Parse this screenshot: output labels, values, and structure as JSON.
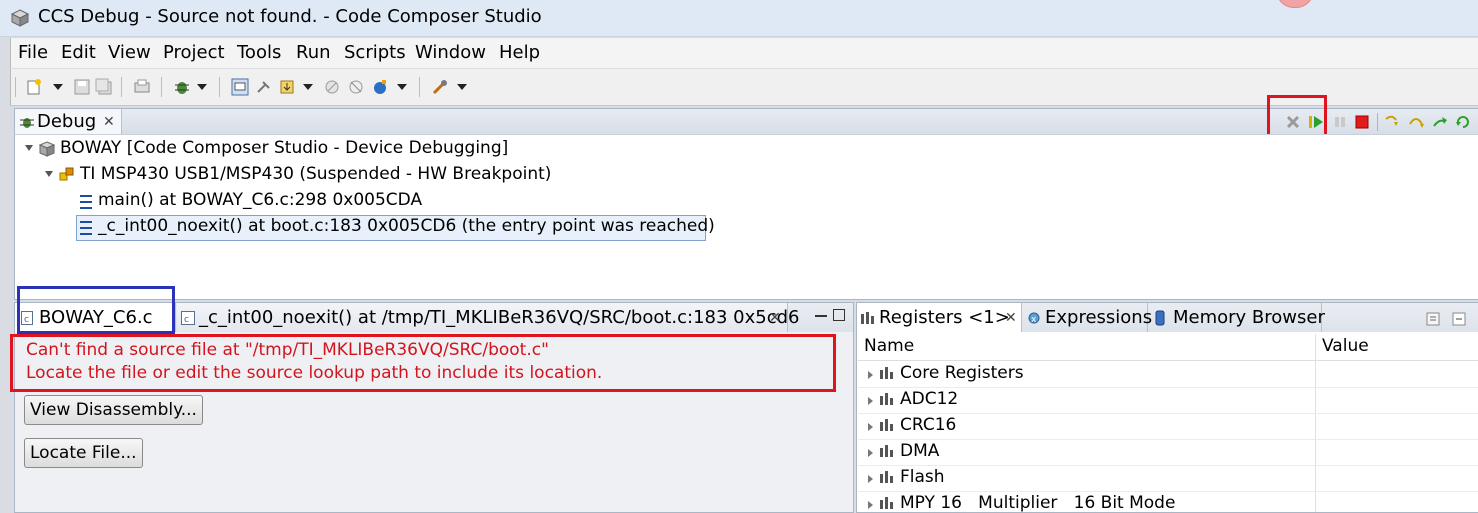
{
  "window": {
    "title": "CCS Debug - Source not found. - Code Composer Studio"
  },
  "menu": [
    "File",
    "Edit",
    "View",
    "Project",
    "Tools",
    "Run",
    "Scripts",
    "Window",
    "Help"
  ],
  "debug_view": {
    "tab_label": "Debug",
    "tree": {
      "session": "BOWAY [Code Composer Studio - Device Debugging]",
      "target": "TI MSP430 USB1/MSP430 (Suspended - HW Breakpoint)",
      "frames": [
        "main() at BOWAY_C6.c:298 0x005CDA",
        "_c_int00_noexit() at boot.c:183 0x005CD6  (the entry point was reached)"
      ]
    }
  },
  "editor": {
    "tabs": [
      "BOWAY_C6.c",
      "_c_int00_noexit() at /tmp/TI_MKLIBeR36VQ/SRC/boot.c:183 0x5cd6"
    ],
    "error_line1": "Can't find a source file at \"/tmp/TI_MKLIBeR36VQ/SRC/boot.c\"",
    "error_line2": "Locate the file or edit the source lookup path to include its location.",
    "view_disassembly_label": "View Disassembly...",
    "locate_file_label": "Locate File..."
  },
  "registers_view": {
    "tabs": [
      "Registers <1>",
      "Expressions",
      "Memory Browser"
    ],
    "columns": [
      "Name",
      "Value"
    ],
    "rows": [
      "Core Registers",
      "ADC12",
      "CRC16",
      "DMA",
      "Flash",
      "MPY 16   Multiplier   16 Bit Mode"
    ]
  },
  "colors": {
    "highlight_red": "#e0141e",
    "highlight_blue": "#2b32b8",
    "error_text": "#d2141e",
    "selection": "#e8f1fb"
  }
}
